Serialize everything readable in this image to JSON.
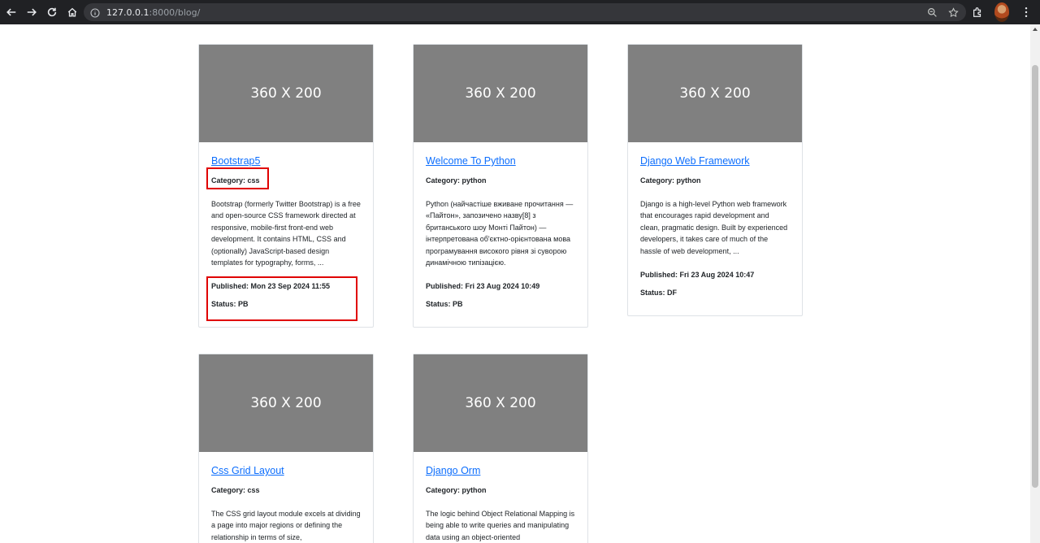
{
  "browser": {
    "url_host": "127.0.0.1",
    "url_rest": ":8000/blog/"
  },
  "cards": [
    {
      "image_label": "360 X 200",
      "title": "Bootstrap5",
      "category": "Category: css",
      "excerpt": "Bootstrap (formerly Twitter Bootstrap) is a free and open-source CSS framework directed at responsive, mobile-first front-end web development. It contains HTML, CSS and (optionally) JavaScript-based design templates for typography, forms, ...",
      "published": "Published: Mon 23 Sep 2024 11:55",
      "status": "Status: PB"
    },
    {
      "image_label": "360 X 200",
      "title": "Welcome To Python",
      "category": "Category: python",
      "excerpt": "Python (найчастіше вживане прочитання — «Пайтон», запозичено назву[8] з британського шоу Монті Пайтон) — інтерпретована об'єктно-орієнтована мова програмування високого рівня зі суворою динамічною типізацією.",
      "published": "Published: Fri 23 Aug 2024 10:49",
      "status": "Status: PB"
    },
    {
      "image_label": "360 X 200",
      "title": "Django Web Framework",
      "category": "Category: python",
      "excerpt": "Django is a high-level Python web framework that encourages rapid development and clean, pragmatic design. Built by experienced developers, it takes care of much of the hassle of web development, ...",
      "published": "Published: Fri 23 Aug 2024 10:47",
      "status": "Status: DF"
    },
    {
      "image_label": "360 X 200",
      "title": "Css Grid Layout",
      "category": "Category: css",
      "excerpt": "The CSS grid layout module excels at dividing a page into major regions or defining the relationship in terms of size,",
      "published": "",
      "status": ""
    },
    {
      "image_label": "360 X 200",
      "title": "Django Orm",
      "category": "Category: python",
      "excerpt": "The logic behind Object Relational Mapping is being able to write queries and manipulating data using an object-oriented",
      "published": "",
      "status": ""
    }
  ],
  "colors": {
    "link": "#0d6efd",
    "placeholder": "#808080",
    "highlight": "#e00000"
  }
}
